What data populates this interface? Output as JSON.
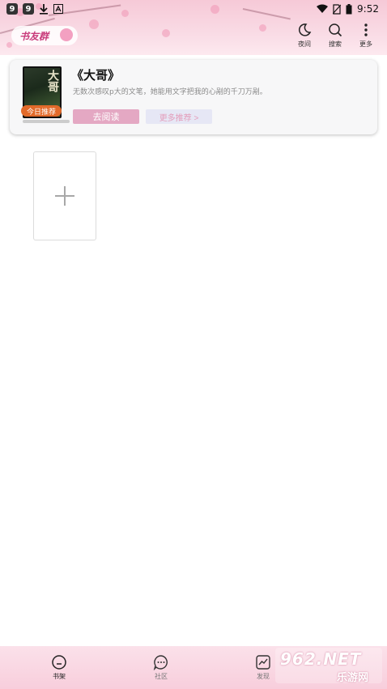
{
  "status_bar": {
    "left_badges": [
      "9",
      "9"
    ],
    "time": "9:52"
  },
  "header": {
    "group_chip_label": "书友群",
    "actions": [
      {
        "icon": "moon-icon",
        "label": "夜间"
      },
      {
        "icon": "search-icon",
        "label": "搜索"
      },
      {
        "icon": "more-vertical-icon",
        "label": "更多"
      }
    ]
  },
  "recommendation": {
    "badge": "今日推荐",
    "cover_title": "大哥",
    "title": "《大哥》",
    "description": "无数次感叹p大的文笔，她能用文字把我的心剐的千刀万剐。",
    "read_button": "去阅读",
    "more_button": "更多推荐 >"
  },
  "bottom_nav": {
    "items": [
      {
        "icon": "bookshelf-icon",
        "label": "书架",
        "active": true
      },
      {
        "icon": "community-icon",
        "label": "社区",
        "active": false
      },
      {
        "icon": "discover-icon",
        "label": "发现",
        "active": false
      }
    ]
  },
  "watermark": {
    "top": "962.NET",
    "bottom": "乐游网"
  },
  "colors": {
    "accent_pink": "#e4a8c3",
    "badge_orange": "#e26a2a",
    "header_bg": "#f6c9d7"
  }
}
